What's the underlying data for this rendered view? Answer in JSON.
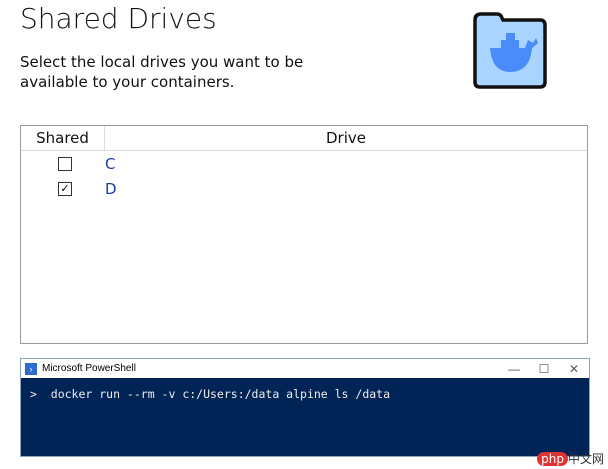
{
  "title": "Shared Drives",
  "description": "Select the local drives you want to be available to your containers.",
  "table": {
    "headers": [
      "Shared",
      "Drive"
    ],
    "rows": [
      {
        "drive": "C",
        "shared": false
      },
      {
        "drive": "D",
        "shared": true
      }
    ]
  },
  "terminal": {
    "title": "Microsoft PowerShell",
    "command": ">  docker run --rm -v c:/Users:/data alpine ls /data"
  },
  "watermark": {
    "brand": "php",
    "text": "中文网"
  },
  "colors": {
    "terminal_bg": "#012456",
    "drive_link": "#1a3a9c",
    "folder": "#a8d4ff",
    "whale": "#4a8df8"
  }
}
